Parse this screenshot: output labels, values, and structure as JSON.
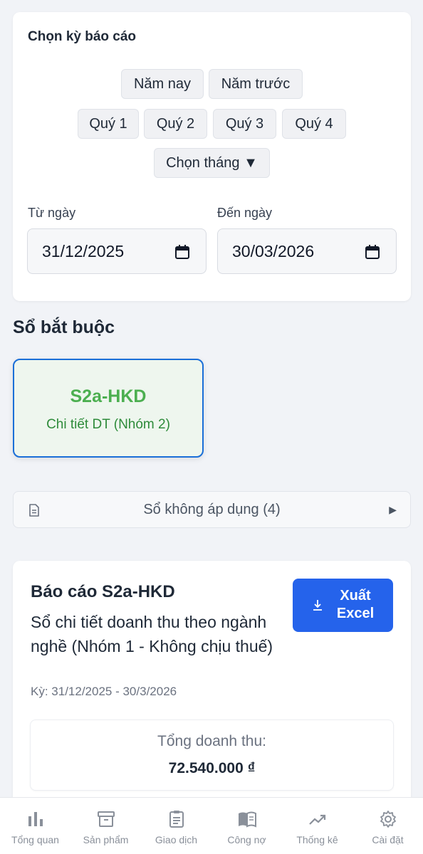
{
  "period_selector": {
    "title": "Chọn kỳ báo cáo",
    "chips_row1": [
      "Năm nay",
      "Năm trước"
    ],
    "chips_row2": [
      "Quý 1",
      "Quý 2",
      "Quý 3",
      "Quý 4"
    ],
    "month_picker": "Chọn tháng ▼",
    "from_label": "Từ ngày",
    "from_value": "31/12/2025",
    "to_label": "Đến ngày",
    "to_value": "30/03/2026"
  },
  "required_books": {
    "title": "Sổ bắt buộc",
    "items": [
      {
        "code": "S2a-HKD",
        "desc": "Chi tiết DT (Nhóm 2)"
      }
    ]
  },
  "not_applicable": {
    "label": "Sổ không áp dụng (4)",
    "arrow": "▶"
  },
  "report": {
    "title": "Báo cáo S2a-HKD",
    "subtitle": "Sổ chi tiết doanh thu theo ngành nghề (Nhóm 1 - Không chịu thuế)",
    "period": "Kỳ: 31/12/2025 - 30/3/2026",
    "export_label": "Xuất Excel",
    "total_label": "Tổng doanh thu:",
    "total_value": "72.540.000 ₫"
  },
  "bottom_nav": [
    {
      "label": "Tổng quan",
      "icon": "bar-chart-icon"
    },
    {
      "label": "Sản phẩm",
      "icon": "box-icon"
    },
    {
      "label": "Giao dịch",
      "icon": "clipboard-icon"
    },
    {
      "label": "Công nợ",
      "icon": "book-icon"
    },
    {
      "label": "Thống kê",
      "icon": "trend-icon"
    },
    {
      "label": "Cài đặt",
      "icon": "gear-icon"
    }
  ],
  "colors": {
    "accent": "#2563eb",
    "book_selected_border": "#1b6fd8",
    "book_code": "#4caf50",
    "nav_text": "#8a909a"
  }
}
